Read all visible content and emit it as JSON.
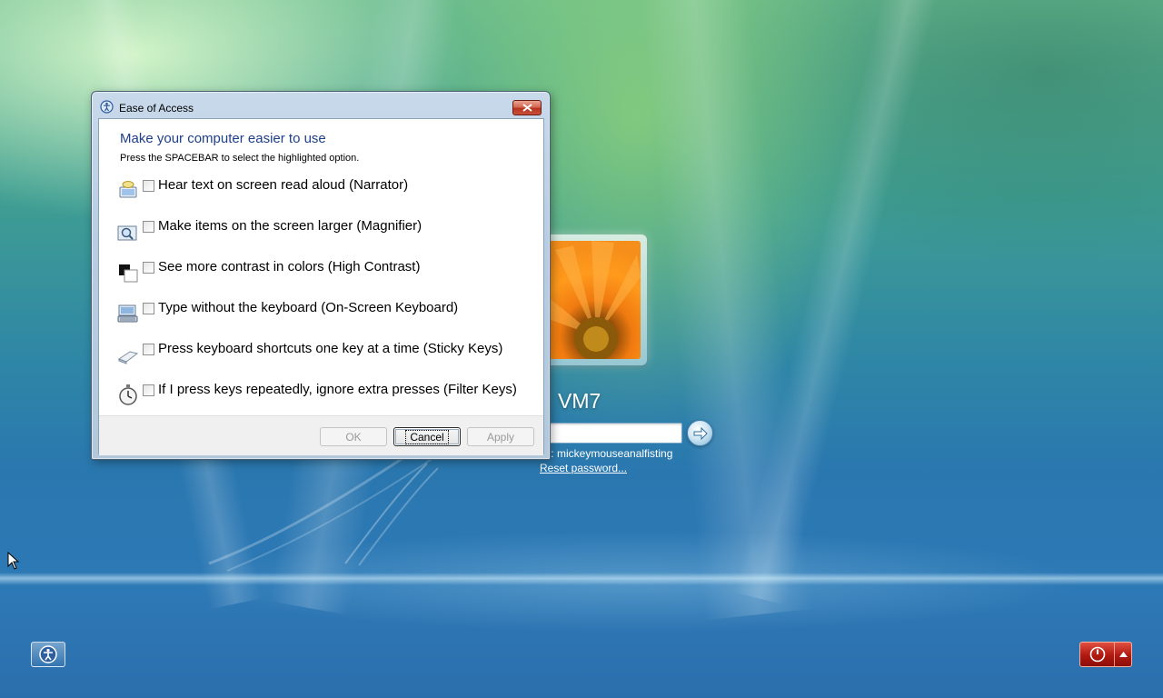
{
  "dialog": {
    "title": "Ease of Access",
    "close_icon": "close-icon",
    "heading": "Make your computer easier to use",
    "instruction": "Press the SPACEBAR to select the highlighted option.",
    "options": [
      {
        "label": "Hear text on screen read aloud (Narrator)",
        "icon": "narrator-icon",
        "checked": false
      },
      {
        "label": "Make items on the screen larger (Magnifier)",
        "icon": "magnifier-icon",
        "checked": false
      },
      {
        "label": "See more contrast in colors (High Contrast)",
        "icon": "high-contrast-icon",
        "checked": false
      },
      {
        "label": "Type without the keyboard (On-Screen Keyboard)",
        "icon": "on-screen-keyboard-icon",
        "checked": false
      },
      {
        "label": "Press keyboard shortcuts one key at a time (Sticky Keys)",
        "icon": "sticky-keys-icon",
        "checked": false
      },
      {
        "label": "If I press keys repeatedly, ignore extra presses (Filter Keys)",
        "icon": "filter-keys-icon",
        "checked": false
      }
    ],
    "buttons": {
      "ok": "OK",
      "cancel": "Cancel",
      "apply": "Apply"
    }
  },
  "login": {
    "user_name": "VM7",
    "password_value": "",
    "hint": "t: mickeymouseanalfisting",
    "reset_link": "Reset password...",
    "submit_icon": "arrow-right-icon"
  },
  "bottom": {
    "ease_icon": "ease-of-access-icon",
    "power_icon": "power-icon",
    "power_menu_icon": "chevron-up-icon"
  },
  "colors": {
    "heading": "#1e3f8a",
    "power_button": "#b01810"
  }
}
